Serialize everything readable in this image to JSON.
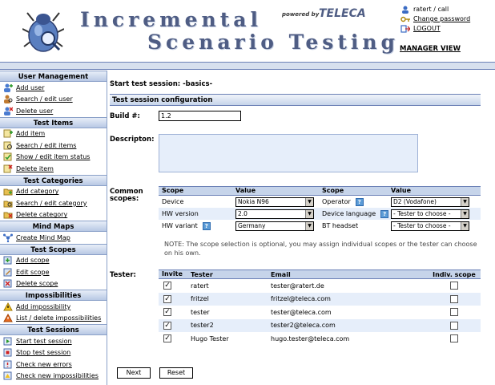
{
  "header": {
    "title_line1": "Incremental",
    "title_line2": "Scenario Testing",
    "powered_by": "powered by",
    "brand": "TELECA",
    "user": "ratert / call",
    "change_password": "Change password",
    "logout": "LOGOUT",
    "manager_view": "MANAGER VIEW"
  },
  "sidebar": {
    "sections": [
      {
        "title": "User Management",
        "items": [
          "Add user",
          "Search / edit user",
          "Delete user"
        ]
      },
      {
        "title": "Test Items",
        "items": [
          "Add item",
          "Search / edit items",
          "Show / edit item status",
          "Delete item"
        ]
      },
      {
        "title": "Test Categories",
        "items": [
          "Add category",
          "Search / edit category",
          "Delete category"
        ]
      },
      {
        "title": "Mind Maps",
        "items": [
          "Create Mind Map"
        ]
      },
      {
        "title": "Test Scopes",
        "items": [
          "Add scope",
          "Edit scope",
          "Delete scope"
        ]
      },
      {
        "title": "Impossibilities",
        "items": [
          "Add impossibility",
          "List / delete impossibilities"
        ]
      },
      {
        "title": "Test Sessions",
        "items": [
          "Start test session",
          "Stop test session",
          "Check new errors",
          "Check new impossibilities"
        ]
      }
    ]
  },
  "main": {
    "session_title": "Start test session: -basics-",
    "config_title": "Test session configuration",
    "build_label": "Build #:",
    "build_value": "1.2",
    "description_label": "Descripton:",
    "scopes_label_1": "Common",
    "scopes_label_2": "scopes:",
    "scope_headers": [
      "Scope",
      "Value",
      "Scope",
      "Value"
    ],
    "scope_rows": [
      {
        "scope1": "Device",
        "value1": "Nokia N96",
        "help1": false,
        "scope2": "Operator",
        "help2": true,
        "value2": "D2 (Vodafone)"
      },
      {
        "scope1": "HW version",
        "value1": "2.0",
        "help1": false,
        "scope2": "Device language",
        "help2": true,
        "value2": "- Tester to choose -"
      },
      {
        "scope1": "HW variant",
        "value1": "Germany",
        "help1": true,
        "scope2": "BT headset",
        "help2": false,
        "value2": "- Tester to choose -"
      }
    ],
    "scope_note": "NOTE: The scope selection is optional, you may assign individual scopes or the tester can choose on his own.",
    "tester_label": "Tester:",
    "tester_headers": [
      "Invite",
      "Tester",
      "Email",
      "Indiv. scope"
    ],
    "testers": [
      {
        "name": "ratert",
        "email": "tester@ratert.de",
        "invite": true
      },
      {
        "name": "fritzel",
        "email": "fritzel@teleca.com",
        "invite": true
      },
      {
        "name": "tester",
        "email": "tester@teleca.com",
        "invite": true
      },
      {
        "name": "tester2",
        "email": "tester2@teleca.com",
        "invite": true
      },
      {
        "name": "Hugo Tester",
        "email": "hugo.tester@teleca.com",
        "invite": true
      }
    ],
    "next_button": "Next",
    "reset_button": "Reset"
  },
  "colors": {
    "accent": "#4f5d84",
    "bar": "#c6d4ea",
    "row_alt": "#e6eefa"
  }
}
